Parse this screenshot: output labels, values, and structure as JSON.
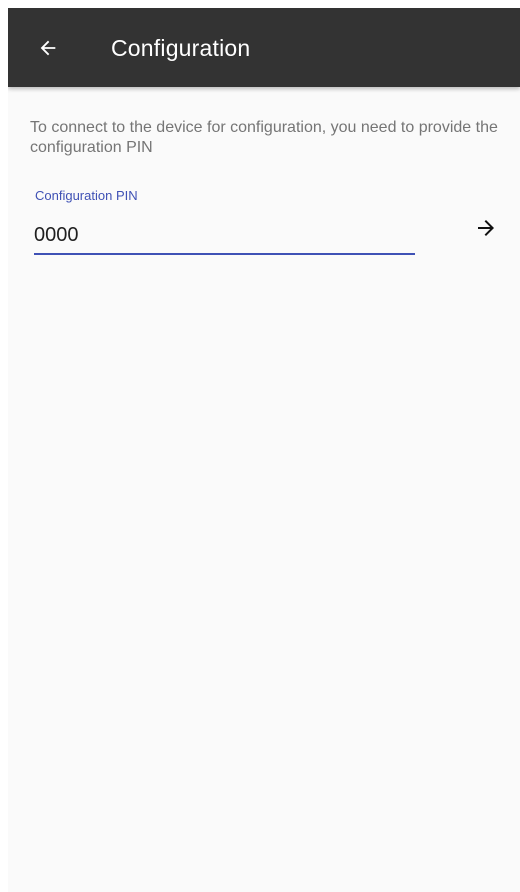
{
  "app_bar": {
    "title": "Configuration",
    "back_icon": "arrow-left-icon",
    "background": "#333333"
  },
  "content": {
    "description": "To connect to the device for configuration, you need to provide the configuration PIN",
    "pin_field": {
      "label": "Configuration PIN",
      "value": "0000"
    },
    "submit_icon": "arrow-right-icon",
    "accent_color": "#3f51b5"
  }
}
